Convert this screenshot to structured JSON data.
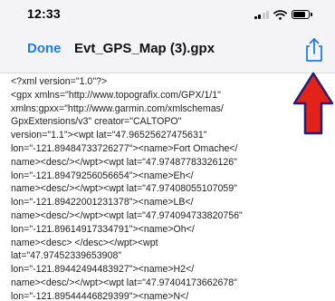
{
  "status_bar": {
    "time": "12:33"
  },
  "nav": {
    "done_label": "Done",
    "title": "Evt_GPS_Map (3).gpx"
  },
  "icons": {
    "share": "share-icon",
    "signal": "signal-icon",
    "wifi": "wifi-icon",
    "battery": "battery-icon",
    "annotation": "red-arrow-icon"
  },
  "colors": {
    "accent": "#1a7cf5",
    "arrow": "#e32219",
    "arrow_outline": "#1f1f7a"
  },
  "document": {
    "lines": [
      "<?xml version=\"1.0\"?>",
      "<gpx xmlns=\"http://www.topografix.com/GPX/1/1\"",
      "xmlns:gpxx=\"http://www.garmin.com/xmlschemas/",
      "GpxExtensions/v3\" creator=\"CALTOPO\"",
      "version=\"1.1\"><wpt lat=\"47.96525627475631\"",
      "lon=\"-121.89484733726277\"><name>Fort Omache</",
      "name><desc/></wpt><wpt lat=\"47.97487783326126\"",
      "lon=\"-121.89479256056654\"><name>Eh</",
      "name><desc/></wpt><wpt lat=\"47.97408055107059\"",
      "lon=\"-121.89422001231378\"><name>LB</",
      "name><desc/></wpt><wpt lat=\"47.974094733820756\"",
      "lon=\"-121.89614917334791\"><name>Oh</",
      "name><desc> </desc></wpt><wpt",
      "lat=\"47.97452339653908\"",
      "lon=\"-121.89442494483927\"><name>H2</",
      "name><desc/></wpt><wpt lat=\"47.97404173662678\"",
      "lon=\"-121.89544446829399\"><name>N</"
    ]
  }
}
